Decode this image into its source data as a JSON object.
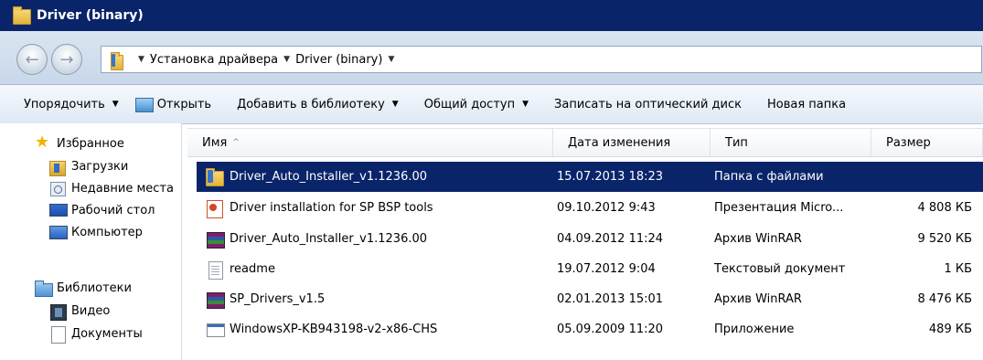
{
  "window": {
    "title": "Driver (binary)",
    "title_bar_color": "#0a246a"
  },
  "address_bar": {
    "breadcrumbs": [
      "Установка драйвера",
      "Driver (binary)"
    ]
  },
  "toolbar": {
    "organize": "Упорядочить",
    "open": "Открыть",
    "add_to_library": "Добавить в библиотеку",
    "share": "Общий доступ",
    "burn": "Записать на оптический диск",
    "new_folder": "Новая папка"
  },
  "nav": {
    "favorites": "Избранное",
    "downloads": "Загрузки",
    "recent": "Недавние места",
    "desktop": "Рабочий стол",
    "computer": "Компьютер",
    "libraries": "Библиотеки",
    "video": "Видео",
    "documents": "Документы"
  },
  "columns": {
    "name": "Имя",
    "date": "Дата изменения",
    "type": "Тип",
    "size": "Размер"
  },
  "files": [
    {
      "name": "Driver_Auto_Installer_v1.1236.00",
      "date": "15.07.2013 18:23",
      "type": "Папка с файлами",
      "size": "",
      "icon": "folder-icon",
      "selected": true
    },
    {
      "name": "Driver installation for SP BSP tools",
      "date": "09.10.2012 9:43",
      "type": "Презентация Micro...",
      "size": "4 808 КБ",
      "icon": "powerpoint-icon"
    },
    {
      "name": "Driver_Auto_Installer_v1.1236.00",
      "date": "04.09.2012 11:24",
      "type": "Архив WinRAR",
      "size": "9 520 КБ",
      "icon": "winrar-icon"
    },
    {
      "name": "readme",
      "date": "19.07.2012 9:04",
      "type": "Текстовый документ",
      "size": "1 КБ",
      "icon": "text-file-icon"
    },
    {
      "name": "SP_Drivers_v1.5",
      "date": "02.01.2013 15:01",
      "type": "Архив WinRAR",
      "size": "8 476 КБ",
      "icon": "winrar-icon"
    },
    {
      "name": "WindowsXP-KB943198-v2-x86-CHS",
      "date": "05.09.2009 11:20",
      "type": "Приложение",
      "size": "489 КБ",
      "icon": "application-icon"
    }
  ],
  "colors": {
    "selection": "#0a246a",
    "folder": "#e2b33a"
  }
}
